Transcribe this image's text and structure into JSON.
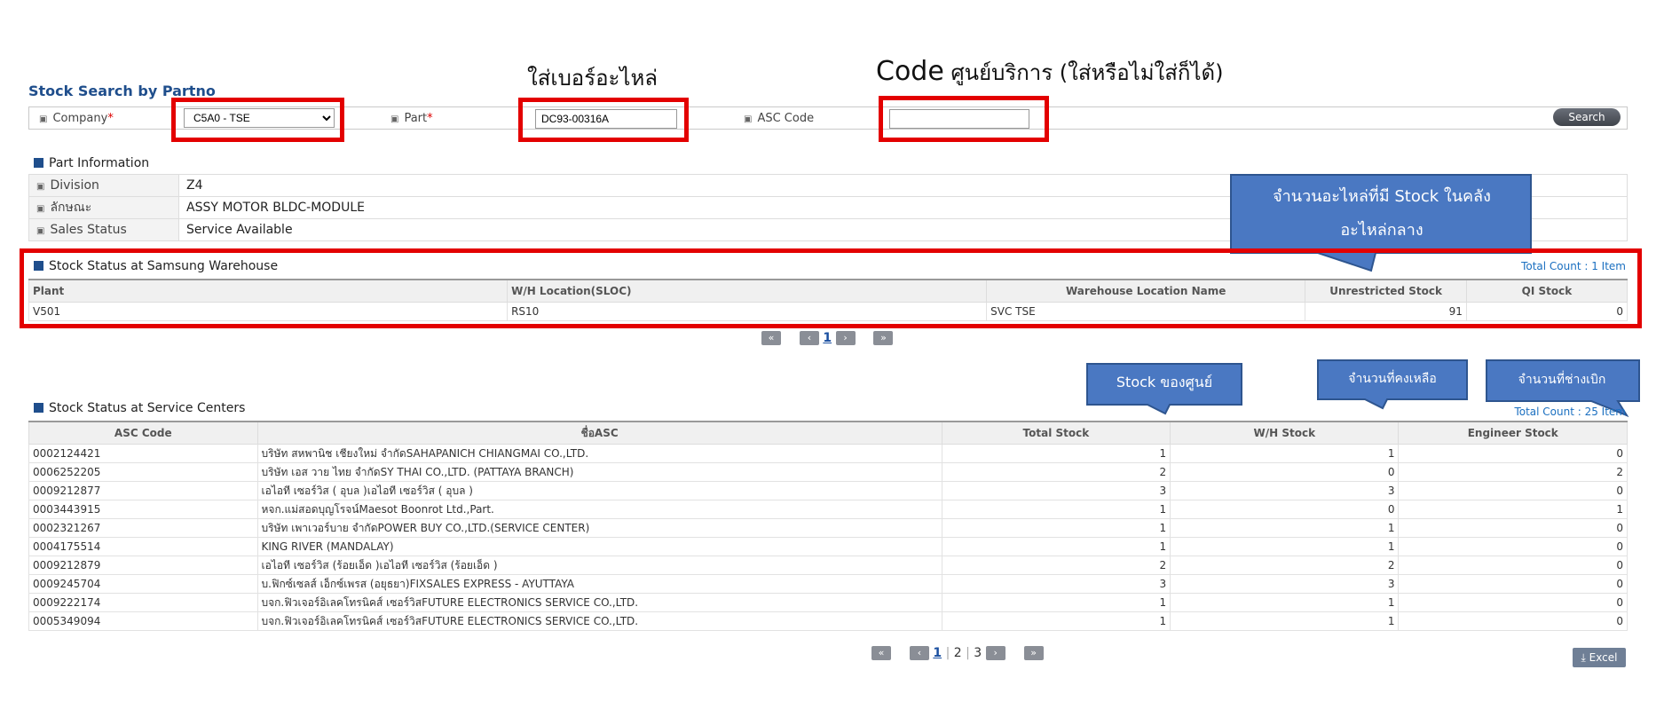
{
  "page_title": "Stock Search by Partno",
  "callouts": {
    "part_label": "ใส่เบอร์อะไหล่",
    "asc_label_code": "Code",
    "asc_label_rest": " ศูนย์บริการ (ใส่หรือไม่ใส่ก็ได้)",
    "warehouse_stock_line1": "จำนวนอะไหล่ที่มี Stock ในคลัง",
    "warehouse_stock_line2": "อะไหล่กลาง",
    "center_stock": "Stock ของศูนย์",
    "remaining": "จำนวนที่คงเหลือ",
    "engineer": "จำนวนที่ช่างเบิก"
  },
  "search": {
    "company_label": "Company",
    "company_value": "C5A0 - TSE",
    "part_label": "Part",
    "part_value": "DC93-00316A",
    "asc_label": "ASC Code",
    "asc_value": "",
    "search_button": "Search"
  },
  "part_info": {
    "heading": "Part Information",
    "rows": [
      {
        "key": "Division",
        "value": "Z4"
      },
      {
        "key": "ลักษณะ",
        "value": "ASSY MOTOR BLDC-MODULE"
      },
      {
        "key": "Sales Status",
        "value": "Service Available"
      }
    ]
  },
  "warehouse": {
    "heading": "Stock Status at Samsung Warehouse",
    "total_count": "Total Count : 1 Item",
    "columns": [
      "Plant",
      "W/H Location(SLOC)",
      "Warehouse Location Name",
      "Unrestricted Stock",
      "QI Stock"
    ],
    "rows": [
      [
        "V501",
        "RS10",
        "SVC TSE",
        "91",
        "0"
      ]
    ],
    "page": "1"
  },
  "service_centers": {
    "heading": "Stock Status at Service Centers",
    "total_count": "Total Count : 25 Item",
    "columns": [
      "ASC Code",
      "ชื่อASC",
      "Total Stock",
      "W/H Stock",
      "Engineer Stock"
    ],
    "rows": [
      [
        "0002124421",
        "บริษัท สหพานิช เชียงใหม่ จำกัดSAHAPANICH CHIANGMAI CO.,LTD.",
        "1",
        "1",
        "0"
      ],
      [
        "0006252205",
        "บริษัท เอส วาย ไทย จำกัดSY THAI CO.,LTD. (PATTAYA BRANCH)",
        "2",
        "0",
        "2"
      ],
      [
        "0009212877",
        "เอไอที เซอร์วิส ( อุบล )เอไอที เซอร์วิส ( อุบล )",
        "3",
        "3",
        "0"
      ],
      [
        "0003443915",
        "หจก.แม่สอดบุญโรจน์Maesot Boonrot Ltd.,Part.",
        "1",
        "0",
        "1"
      ],
      [
        "0002321267",
        "บริษัท เพาเวอร์บาย จำกัดPOWER BUY CO.,LTD.(SERVICE CENTER)",
        "1",
        "1",
        "0"
      ],
      [
        "0004175514",
        "KING RIVER (MANDALAY)",
        "1",
        "1",
        "0"
      ],
      [
        "0009212879",
        "เอไอที เซอร์วิส (ร้อยเอ็ด )เอไอที เซอร์วิส (ร้อยเอ็ด )",
        "2",
        "2",
        "0"
      ],
      [
        "0009245704",
        "บ.ฟิกซ์เซลส์ เอ็กซ์เพรส (อยุธยา)FIXSALES EXPRESS - AYUTTAYA",
        "3",
        "3",
        "0"
      ],
      [
        "0009222174",
        "บจก.ฟิวเจอร์อิเลคโทรนิคส์ เซอร์วิสFUTURE ELECTRONICS SERVICE CO.,LTD.",
        "1",
        "1",
        "0"
      ],
      [
        "0005349094",
        "บจก.ฟิวเจอร์อิเลคโทรนิคส์ เซอร์วิสFUTURE ELECTRONICS SERVICE CO.,LTD.",
        "1",
        "1",
        "0"
      ]
    ],
    "pages": [
      "1",
      "2",
      "3"
    ],
    "excel_button": "Excel"
  },
  "colors": {
    "accent": "#1f4e8c",
    "highlight": "#e30000",
    "callout": "#4a78c2"
  }
}
